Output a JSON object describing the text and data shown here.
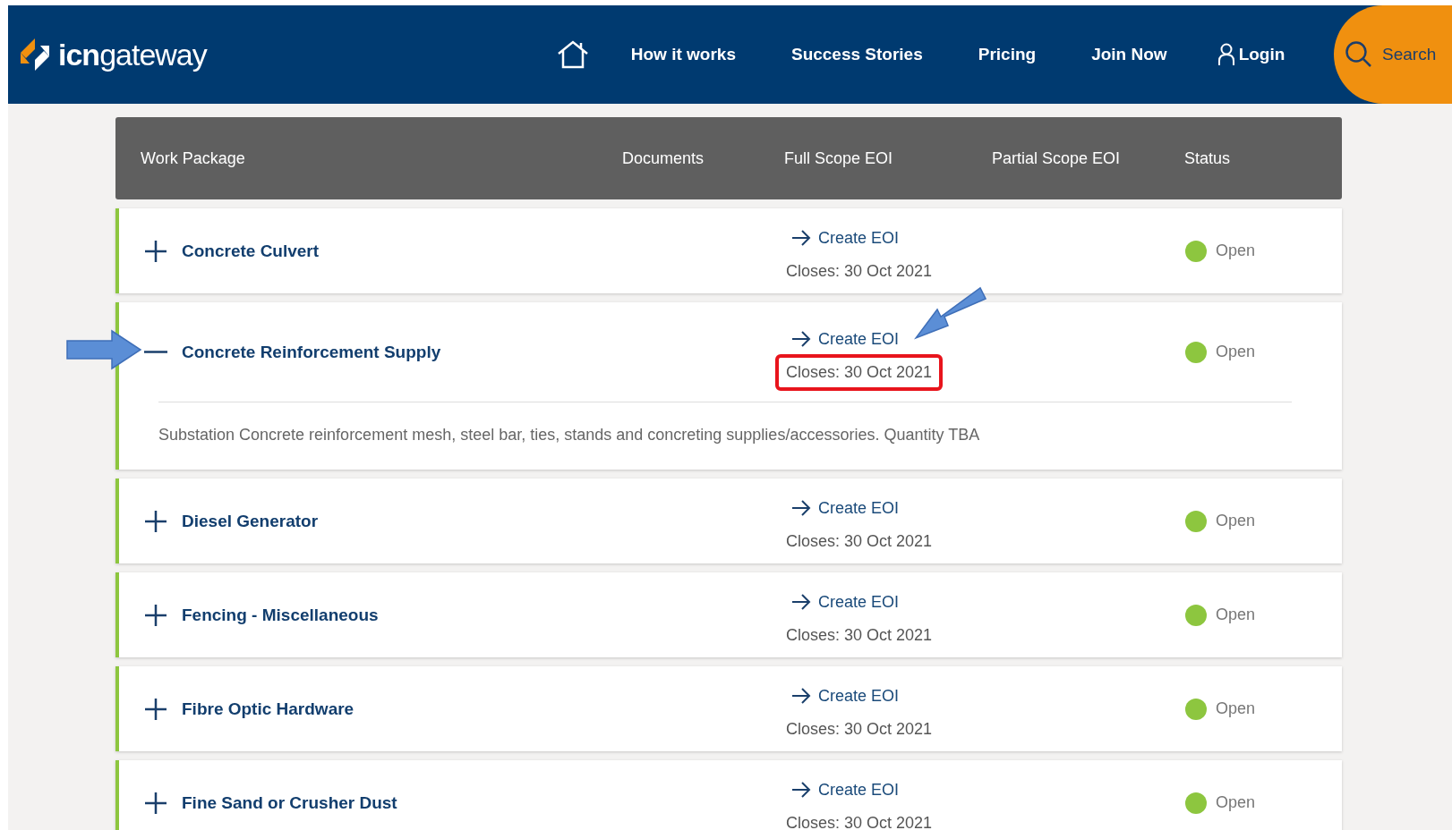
{
  "header": {
    "logo": "**icn**gateway",
    "nav": [
      "How it works",
      "Success Stories",
      "Pricing",
      "Join Now"
    ],
    "login": "Login",
    "search": "Search"
  },
  "table": {
    "columns": [
      "Work Package",
      "Documents",
      "Full Scope EOI",
      "Partial Scope EOI",
      "Status"
    ],
    "rows": [
      {
        "name": "Concrete Culvert",
        "expanded": false,
        "action": "Create EOI",
        "closes": "Closes: 30 Oct 2021",
        "status": "Open",
        "color": "#8dc63f",
        "highlighted": false
      },
      {
        "name": "Concrete Reinforcement Supply",
        "expanded": true,
        "action": "Create EOI",
        "closes": "Closes: 30 Oct 2021",
        "status": "Open",
        "color": "#8dc63f",
        "highlighted": true,
        "description": "Substation Concrete reinforcement mesh, steel bar, ties, stands and concreting supplies/accessories. Quantity TBA"
      },
      {
        "name": "Diesel Generator",
        "expanded": false,
        "action": "Create EOI",
        "closes": "Closes: 30 Oct 2021",
        "status": "Open",
        "color": "#8dc63f",
        "highlighted": false
      },
      {
        "name": "Fencing - Miscellaneous",
        "expanded": false,
        "action": "Create EOI",
        "closes": "Closes: 30 Oct 2021",
        "status": "Open",
        "color": "#8dc63f",
        "highlighted": false
      },
      {
        "name": "Fibre Optic Hardware",
        "expanded": false,
        "action": "Create EOI",
        "closes": "Closes: 30 Oct 2021",
        "status": "Open",
        "color": "#8dc63f",
        "highlighted": false
      },
      {
        "name": "Fine Sand or Crusher Dust",
        "expanded": false,
        "action": "Create EOI",
        "closes": "Closes: 30 Oct 2021",
        "status": "Open",
        "color": "#8dc63f",
        "highlighted": false
      }
    ]
  }
}
